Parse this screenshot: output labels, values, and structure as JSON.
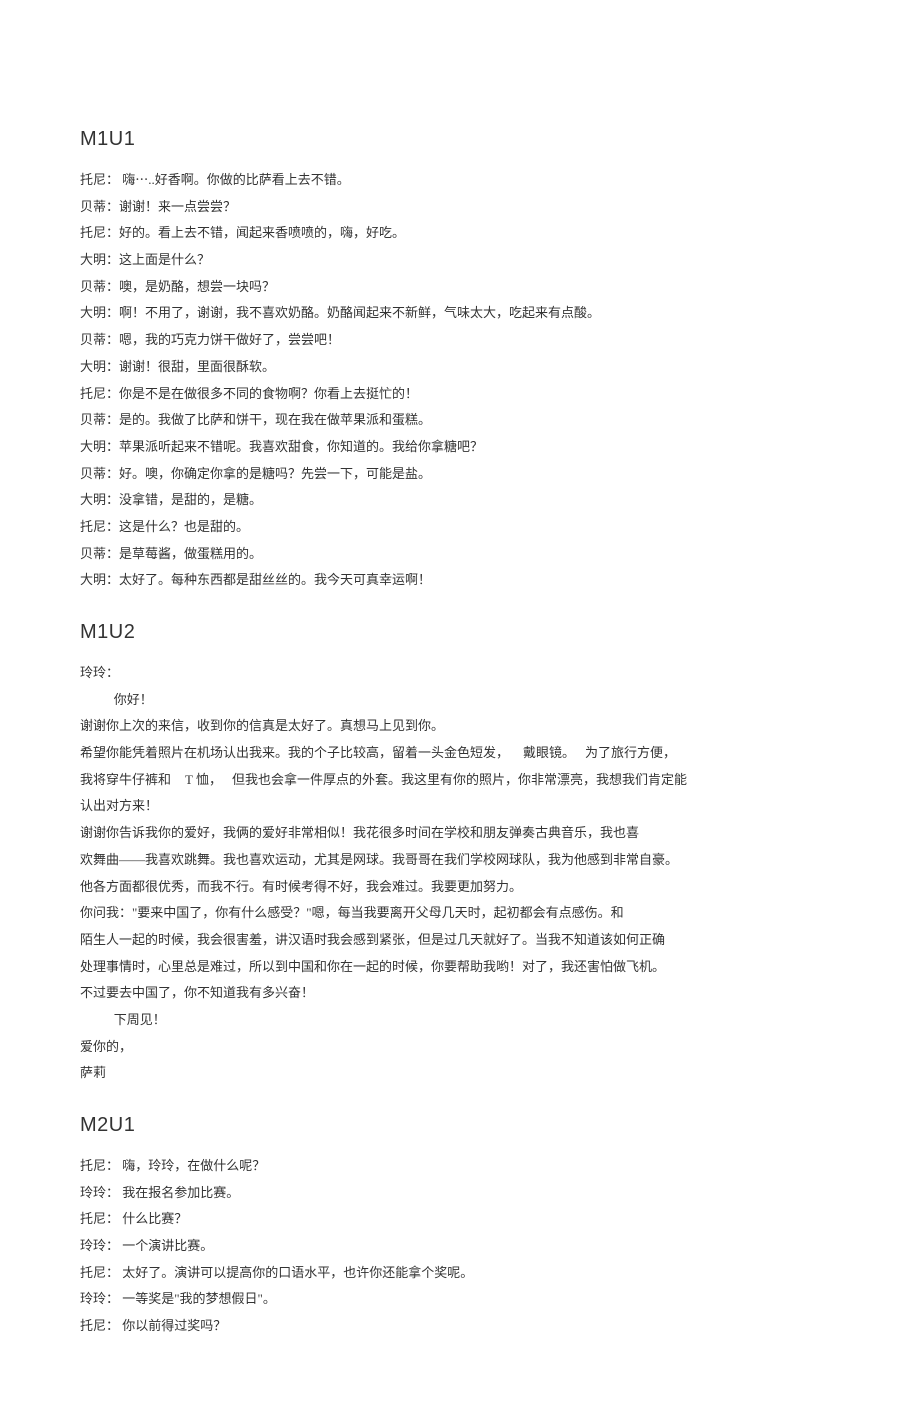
{
  "sections": {
    "m1u1": {
      "title": "M1U1",
      "lines": [
        "托尼：  嗨⋯..好香啊。你做的比萨看上去不错。",
        "贝蒂：谢谢！来一点尝尝？",
        "托尼：好的。看上去不错，闻起来香喷喷的，嗨，好吃。",
        "大明：这上面是什么？",
        "贝蒂：噢，是奶酪，想尝一块吗？",
        "大明：啊！不用了，谢谢，我不喜欢奶酪。奶酪闻起来不新鲜，气味太大，吃起来有点酸。",
        "贝蒂：嗯，我的巧克力饼干做好了，尝尝吧！",
        "大明：谢谢！很甜，里面很酥软。",
        "托尼：你是不是在做很多不同的食物啊？你看上去挺忙的！",
        "贝蒂：是的。我做了比萨和饼干，现在我在做苹果派和蛋糕。",
        "大明：苹果派听起来不错呢。我喜欢甜食，你知道的。我给你拿糖吧？",
        "贝蒂：好。噢，你确定你拿的是糖吗？先尝一下，可能是盐。",
        "大明：没拿错，是甜的，是糖。",
        "托尼：这是什么？也是甜的。",
        "贝蒂：是草莓酱，做蛋糕用的。",
        "大明：太好了。每种东西都是甜丝丝的。我今天可真幸运啊！"
      ]
    },
    "m1u2": {
      "title": "M1U2",
      "salutation": "玲玲：",
      "hello": "你好！",
      "body1_indent": "        谢谢你上次的来信，收到你的信真是太好了。真想马上见到你。",
      "body2_part1": "        希望你能凭着照片在机场认出我来。我的个子比较高，留着一头金色短发，",
      "body2_glasses": "戴眼镜。",
      "body2_trail": "为了旅行方便，",
      "body3_part1": "我将穿牛仔裤和",
      "body3_tshirt": "T 恤，",
      "body3_trail": "但我也会拿一件厚点的外套。我这里有你的照片，你非常漂亮，我想我们肯定能",
      "body4": "认出对方来！",
      "body5": "        谢谢你告诉我你的爱好，我俩的爱好非常相似！我花很多时间在学校和朋友弹奏古典音乐，我也喜",
      "body6": "欢舞曲——我喜欢跳舞。我也喜欢运动，尤其是网球。我哥哥在我们学校网球队，我为他感到非常自豪。",
      "body7": "他各方面都很优秀，而我不行。有时候考得不好，我会难过。我要更加努力。",
      "body8": "        你问我：\"要来中国了，你有什么感受？\"嗯，每当我要离开父母几天时，起初都会有点感伤。和",
      "body9": "陌生人一起的时候，我会很害羞，讲汉语时我会感到紧张，但是过几天就好了。当我不知道该如何正确",
      "body10": "处理事情时，心里总是难过，所以到中国和你在一起的时候，你要帮助我哟！对了，我还害怕做飞机。",
      "body11": "不过要去中国了，你不知道我有多兴奋！",
      "closing_nextweek": "下周见！",
      "closing_love": "爱你的，",
      "closing_name": "萨莉"
    },
    "m2u1": {
      "title": "M2U1",
      "lines": [
        "托尼：  嗨，玲玲，在做什么呢？",
        "玲玲：  我在报名参加比赛。",
        "托尼：  什么比赛？",
        "玲玲：  一个演讲比赛。",
        "托尼：  太好了。演讲可以提高你的口语水平，也许你还能拿个奖呢。",
        "玲玲：  一等奖是\"我的梦想假日\"。",
        "托尼：  你以前得过奖吗？"
      ]
    }
  }
}
